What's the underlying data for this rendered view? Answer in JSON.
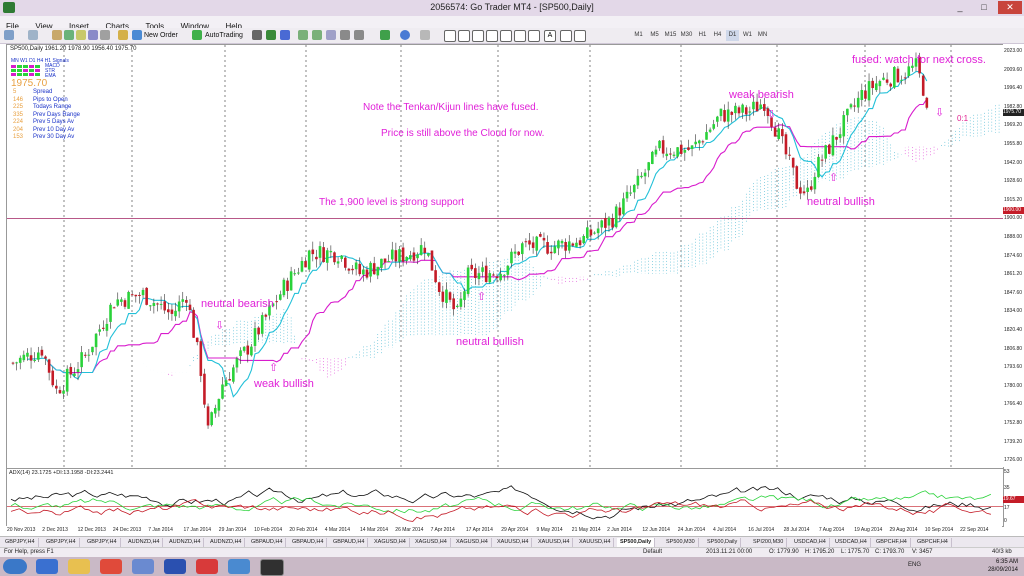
{
  "window": {
    "title": "2056574: Go Trader MT4 - [SP500,Daily]",
    "minimize": "_",
    "maximize": "□",
    "close": "✕"
  },
  "menu": [
    "File",
    "View",
    "Insert",
    "Charts",
    "Tools",
    "Window",
    "Help"
  ],
  "toolbar": {
    "new_order": "New Order",
    "autotrading": "AutoTrading",
    "timeframes": [
      "M1",
      "M5",
      "M15",
      "M30",
      "H1",
      "H4",
      "D1",
      "W1",
      "MN"
    ]
  },
  "chart_header": "SP500,Daily  1961.20 1978.90 1956.40 1975.70",
  "info_panel": {
    "timeframes": [
      "MN",
      "W1",
      "D1",
      "H4",
      "H1",
      "Signals"
    ],
    "signal_labels": [
      "MACD",
      "STR",
      "EMA"
    ],
    "price": "1975.70",
    "rows": [
      {
        "value": "5",
        "label": "Spread",
        "color": "#1a32c8"
      },
      {
        "value": "146",
        "label": "Pips to Open",
        "color": "#1a32c8"
      },
      {
        "value": "225",
        "label": "Todays Range",
        "color": "#1a32c8"
      },
      {
        "value": "335",
        "label": "Prev Days Range",
        "color": "#1a32c8"
      },
      {
        "value": "224",
        "label": "Prev 5 Days Av",
        "color": "#1a32c8"
      },
      {
        "value": "204",
        "label": "Prev 10 Day Av",
        "color": "#1a32c8"
      },
      {
        "value": "153",
        "label": "Prev 30 Day Av",
        "color": "#1a32c8"
      }
    ]
  },
  "annotations": {
    "fused_note": "Note the Tenkan/Kijun lines have fused.",
    "cloud_note": "Price is still above the Cloud for now.",
    "support_note": "The 1,900 level is strong support",
    "weak_bearish": "weak bearish",
    "fused_watch": "fused: watch for next cross.",
    "neutral_bearish": "neutral bearish",
    "weak_bullish": "weak bullish",
    "neutral_bullish_1": "neutral bullish",
    "neutral_bullish_2": "neutral bullish",
    "cross_label": "0:1"
  },
  "y_axis": [
    "2023.00",
    "2009.60",
    "1996.40",
    "1982.80",
    "1969.20",
    "1955.80",
    "1942.00",
    "1928.60",
    "1915.20",
    "1900.00",
    "1888.00",
    "1874.60",
    "1861.20",
    "1847.60",
    "1834.00",
    "1820.40",
    "1806.80",
    "1793.60",
    "1780.00",
    "1766.40",
    "1752.80",
    "1739.20",
    "1726.00"
  ],
  "price_box": "1975.70",
  "level_box": "1900.00",
  "adx_header": "ADX(14) 23.1725 +DI:13.1958 -DI:23.2441",
  "adx_axis": [
    "53",
    "35",
    "17",
    "0"
  ],
  "adx_box": "19.67",
  "x_axis": [
    "20 Nov 2013",
    "2 Dec 2013",
    "12 Dec 2013",
    "24 Dec 2013",
    "7 Jan 2014",
    "17 Jan 2014",
    "29 Jan 2014",
    "10 Feb 2014",
    "20 Feb 2014",
    "4 Mar 2014",
    "14 Mar 2014",
    "26 Mar 2014",
    "7 Apr 2014",
    "17 Apr 2014",
    "29 Apr 2014",
    "9 May 2014",
    "21 May 2014",
    "2 Jun 2014",
    "12 Jun 2014",
    "24 Jun 2014",
    "4 Jul 2014",
    "16 Jul 2014",
    "28 Jul 2014",
    "7 Aug 2014",
    "19 Aug 2014",
    "29 Aug 2014",
    "10 Sep 2014",
    "22 Sep 2014"
  ],
  "tabs": [
    "GBPJPY,H4",
    "GBPJPY,H4",
    "GBPJPY,H4",
    "AUDNZD,H4",
    "AUDNZD,H4",
    "AUDNZD,H4",
    "GBPAUD,H4",
    "GBPAUD,H4",
    "GBPAUD,H4",
    "XAGUSD,H4",
    "XAGUSD,H4",
    "XAGUSD,H4",
    "XAUUSD,H4",
    "XAUUSD,H4",
    "XAUUSD,H4",
    "SP500,Daily",
    "SP500,M30",
    "SP500,Daily",
    "SPI200,M30",
    "USDCAD,H4",
    "USDCAD,H4",
    "GBPCHF,H4",
    "GBPCHF,H4"
  ],
  "active_tab": 15,
  "status": {
    "help": "For Help, press F1",
    "profile": "Default",
    "datetime": "2013.11.21 00:00",
    "open": "O: 1779.90",
    "high": "H: 1795.20",
    "low": "L: 1775.70",
    "close": "C: 1793.70",
    "vol": "V: 3457",
    "conn": "40/3 kb"
  },
  "clock": {
    "time": "6:35 AM",
    "date": "28/09/2014",
    "lang": "ENG"
  },
  "colors": {
    "bull": "#2ad23a",
    "bear": "#c41c28",
    "tenkan": "#22c0d8",
    "kijun": "#d81ccd",
    "cloud": "#22a8c8",
    "annotation": "#e020d8"
  }
}
